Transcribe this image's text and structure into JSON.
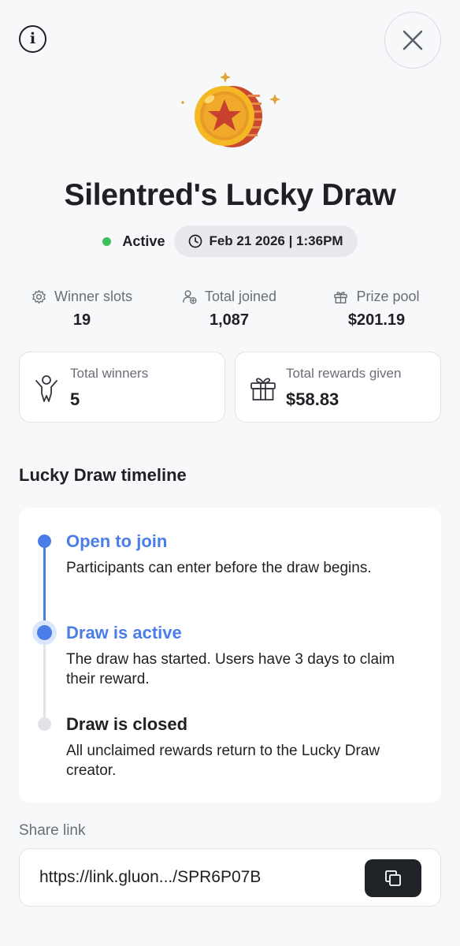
{
  "header": {
    "info_icon": "info-icon",
    "info_glyph": "i",
    "close_icon": "close-icon"
  },
  "hero": {
    "coin_icon": "star-coin-icon",
    "title": "Silentred's Lucky Draw",
    "status": "Active",
    "status_color": "#3fbf5a",
    "date_time": "Feb 21 2026 | 1:36PM"
  },
  "stats": [
    {
      "icon": "gear-icon",
      "label": "Winner slots",
      "value": "19"
    },
    {
      "icon": "user-add-icon",
      "label": "Total joined",
      "value": "1,087"
    },
    {
      "icon": "gift-icon",
      "label": "Prize pool",
      "value": "$201.19"
    }
  ],
  "cards": [
    {
      "icon": "winner-icon",
      "label": "Total winners",
      "value": "5"
    },
    {
      "icon": "gift-box-icon",
      "label": "Total rewards given",
      "value": "$58.83"
    }
  ],
  "timeline": {
    "title": "Lucky Draw timeline",
    "accent_color": "#4a7de8",
    "steps": [
      {
        "title": "Open to join",
        "description": "Participants can enter before the draw begins.",
        "state": "completed"
      },
      {
        "title": "Draw is active",
        "description": "The draw has started. Users have 3 days to claim their reward.",
        "state": "current"
      },
      {
        "title": "Draw is closed",
        "description": "All unclaimed rewards return to the Lucky Draw creator.",
        "state": "upcoming"
      }
    ]
  },
  "share": {
    "label": "Share link",
    "url": "https://link.gluon.../SPR6P07B",
    "copy_icon": "copy-icon"
  }
}
